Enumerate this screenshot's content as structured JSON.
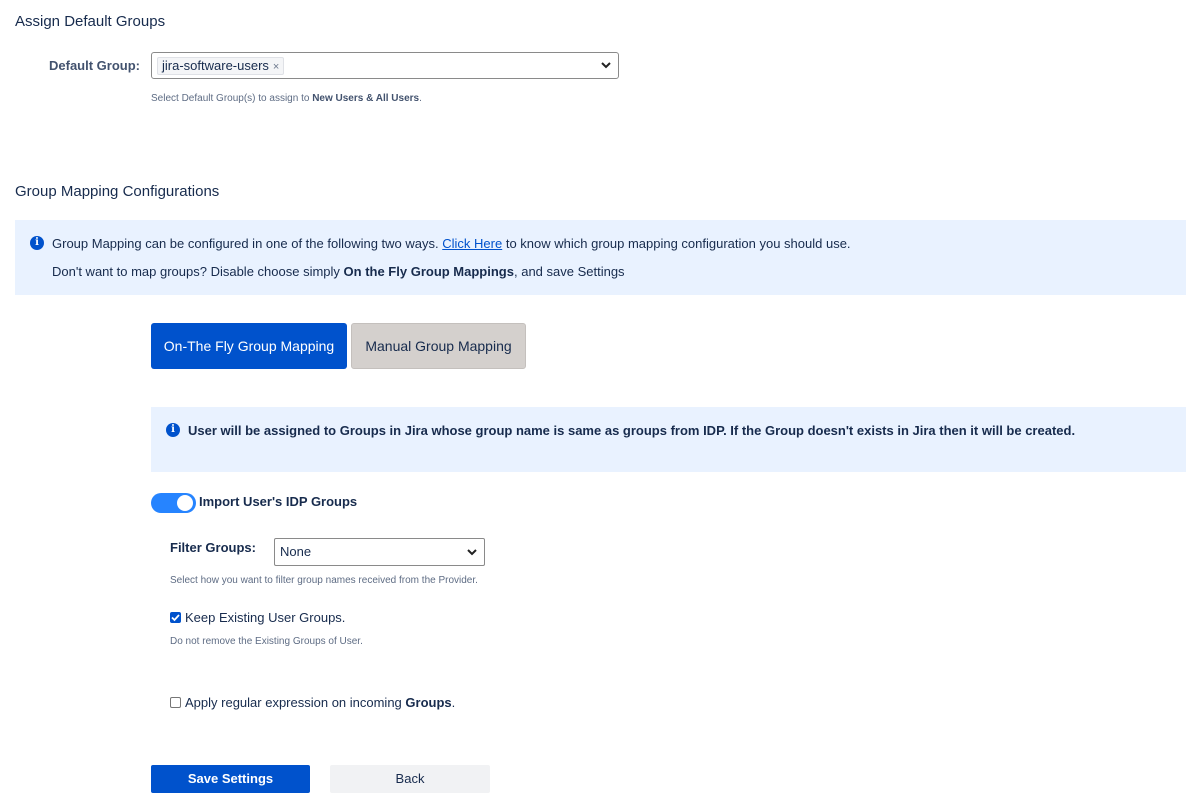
{
  "default_groups": {
    "heading": "Assign Default Groups",
    "label": "Default Group:",
    "selected_chip": "jira-software-users",
    "chip_remove": "×",
    "help_prefix": "Select Default Group(s) to assign to ",
    "help_bold": "New Users & All Users",
    "help_suffix": "."
  },
  "group_mapping": {
    "heading": "Group Mapping Configurations",
    "info_line1_prefix": "Group Mapping can be configured in one of the following two ways. ",
    "info_link": "Click Here",
    "info_line1_suffix": " to know which group mapping configuration you should use.",
    "info_line2_prefix": "Don't want to map groups? Disable choose simply ",
    "info_line2_bold": "On the Fly Group Mappings",
    "info_line2_suffix": ", and save Settings",
    "tabs": [
      {
        "label": "On-The Fly Group Mapping",
        "active": true
      },
      {
        "label": "Manual Group Mapping",
        "active": false
      }
    ],
    "onthefly_info": "User will be assigned to Groups in Jira whose group name is same as groups from IDP. If the Group doesn't exists in Jira then it will be created."
  },
  "import_groups": {
    "label": "Import User's IDP Groups",
    "enabled": true
  },
  "filter_groups": {
    "label": "Filter Groups:",
    "value": "None",
    "help": "Select how you want to filter group names received from the Provider."
  },
  "keep_existing": {
    "label": "Keep Existing User Groups.",
    "checked": true,
    "help": "Do not remove the Existing Groups of User."
  },
  "regex": {
    "label_prefix": "Apply regular expression on incoming ",
    "label_bold": "Groups",
    "label_suffix": ".",
    "checked": false
  },
  "actions": {
    "save_label": "Save Settings",
    "back_label": "Back"
  },
  "colors": {
    "primary": "#0052cc",
    "banner_bg": "#e9f2ff",
    "toggle_on": "#2684ff",
    "inactive_tab": "#d4d0cd"
  },
  "icons": {
    "info": "info-circle-icon",
    "dropdown": "chevron-down-icon",
    "check": "checkmark-icon"
  }
}
